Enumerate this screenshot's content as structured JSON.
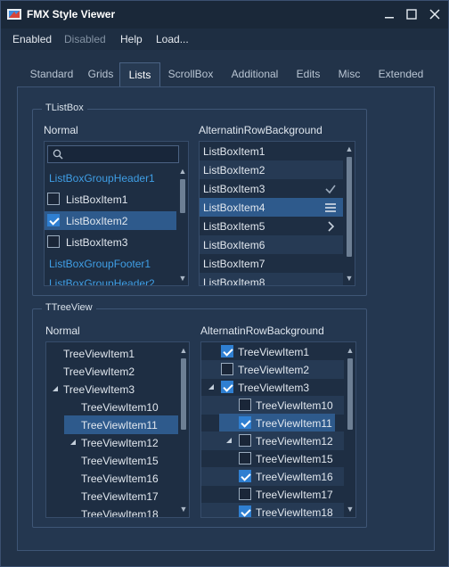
{
  "window": {
    "title": "FMX Style Viewer"
  },
  "menu": [
    "Enabled",
    "Disabled",
    "Help",
    "Load..."
  ],
  "tabs": [
    "Standard",
    "Grids",
    "Lists",
    "ScrollBox",
    "Additional",
    "Edits",
    "Misc",
    "Extended"
  ],
  "listbox_group": {
    "title": "TListBox",
    "normal": {
      "label": "Normal",
      "items": [
        {
          "text": "ListBoxGroupHeader1",
          "kind": "header"
        },
        {
          "text": "ListBoxItem1",
          "checked": false
        },
        {
          "text": "ListBoxItem2",
          "checked": true,
          "selected": true
        },
        {
          "text": "ListBoxItem3",
          "checked": false
        },
        {
          "text": "ListBoxGroupFooter1",
          "kind": "header"
        },
        {
          "text": "ListBoxGroupHeader2",
          "kind": "header"
        }
      ]
    },
    "alternating": {
      "label": "AlternatinRowBackground",
      "items": [
        {
          "text": "ListBoxItem1",
          "accessory": ""
        },
        {
          "text": "ListBoxItem2",
          "accessory": ""
        },
        {
          "text": "ListBoxItem3",
          "accessory": "checkmark-icon"
        },
        {
          "text": "ListBoxItem4",
          "accessory": "menu-lines-icon",
          "selected": true
        },
        {
          "text": "ListBoxItem5",
          "accessory": "chevron-right-icon"
        },
        {
          "text": "ListBoxItem6",
          "accessory": ""
        },
        {
          "text": "ListBoxItem7",
          "accessory": ""
        },
        {
          "text": "ListBoxItem8",
          "accessory": ""
        }
      ]
    }
  },
  "treeview_group": {
    "title": "TTreeView",
    "normal": {
      "label": "Normal",
      "items": [
        {
          "text": "TreeViewItem1",
          "level": 0
        },
        {
          "text": "TreeViewItem2",
          "level": 0
        },
        {
          "text": "TreeViewItem3",
          "level": 0,
          "expanded": true
        },
        {
          "text": "TreeViewItem10",
          "level": 1
        },
        {
          "text": "TreeViewItem11",
          "level": 1,
          "selected": true
        },
        {
          "text": "TreeViewItem12",
          "level": 1,
          "expanded": true
        },
        {
          "text": "TreeViewItem15",
          "level": 1
        },
        {
          "text": "TreeViewItem16",
          "level": 1
        },
        {
          "text": "TreeViewItem17",
          "level": 1
        },
        {
          "text": "TreeViewItem18",
          "level": 1
        }
      ]
    },
    "alternating": {
      "label": "AlternatinRowBackground",
      "items": [
        {
          "text": "TreeViewItem1",
          "level": 0,
          "checked": true
        },
        {
          "text": "TreeViewItem2",
          "level": 0,
          "checked": false
        },
        {
          "text": "TreeViewItem3",
          "level": 0,
          "checked": true,
          "expanded": true
        },
        {
          "text": "TreeViewItem10",
          "level": 1,
          "checked": false
        },
        {
          "text": "TreeViewItem11",
          "level": 1,
          "checked": true,
          "selected": true
        },
        {
          "text": "TreeViewItem12",
          "level": 1,
          "checked": false,
          "expanded": true
        },
        {
          "text": "TreeViewItem15",
          "level": 1,
          "checked": false
        },
        {
          "text": "TreeViewItem16",
          "level": 1,
          "checked": true
        },
        {
          "text": "TreeViewItem17",
          "level": 1,
          "checked": false
        },
        {
          "text": "TreeViewItem18",
          "level": 1,
          "checked": true
        }
      ]
    }
  },
  "colors": {
    "accent": "#2f7fd1",
    "header_text": "#3f9ee5",
    "selection": "#2e5a8c"
  }
}
